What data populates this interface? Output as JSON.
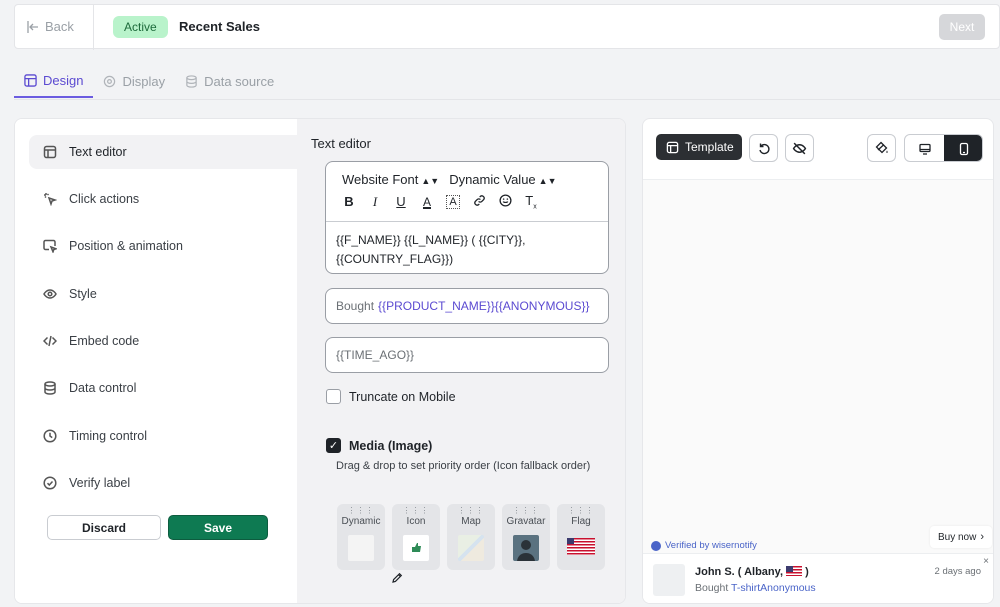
{
  "header": {
    "back_label": "Back",
    "status_badge": "Active",
    "title": "Recent Sales",
    "next_label": "Next"
  },
  "tabs": [
    {
      "label": "Design",
      "icon": "layout-icon",
      "active": true
    },
    {
      "label": "Display",
      "icon": "display-icon",
      "active": false
    },
    {
      "label": "Data source",
      "icon": "database-icon",
      "active": false
    }
  ],
  "side_nav": {
    "items": [
      {
        "label": "Text editor",
        "icon": "text-editor-icon",
        "active": true
      },
      {
        "label": "Click actions",
        "icon": "click-icon"
      },
      {
        "label": "Position & animation",
        "icon": "cursor-window-icon"
      },
      {
        "label": "Style",
        "icon": "eye-icon"
      },
      {
        "label": "Embed code",
        "icon": "code-icon"
      },
      {
        "label": "Data control",
        "icon": "database-icon"
      },
      {
        "label": "Timing control",
        "icon": "clock-icon"
      },
      {
        "label": "Verify label",
        "icon": "check-circle-icon"
      }
    ],
    "discard_label": "Discard",
    "save_label": "Save"
  },
  "editor": {
    "heading": "Text editor",
    "font_select": "Website Font",
    "dynamic_select": "Dynamic Value",
    "content_line1": "{{F_NAME}} {{L_NAME}} ( {{CITY}},",
    "content_line2": "{{COUNTRY_FLAG}})",
    "bought_prefix": "Bought",
    "bought_vars": "{{PRODUCT_NAME}}{{ANONYMOUS}}",
    "time_ago": "{{TIME_AGO}}",
    "truncate_label": "Truncate on Mobile",
    "truncate_checked": false,
    "media_label": "Media (Image)",
    "media_checked": true,
    "media_help": "Drag & drop to set priority order (Icon fallback order)",
    "media_tiles": [
      "Dynamic",
      "Icon",
      "Map",
      "Gravatar",
      "Flag"
    ]
  },
  "preview": {
    "template_label": "Template",
    "verified_text": "Verified by wisernotify",
    "buy_now_label": "Buy now",
    "notif_name": "John S. ( Albany,",
    "notif_name_end": ")",
    "notif_time": "2 days ago",
    "notif_bought": "Bought",
    "notif_product": "T-shirtAnonymous",
    "close_glyph": "×"
  },
  "colors": {
    "accent": "#5b4ad1",
    "save": "#0e7a52",
    "badge_bg": "#b9f3cb",
    "dark": "#1f2328"
  }
}
